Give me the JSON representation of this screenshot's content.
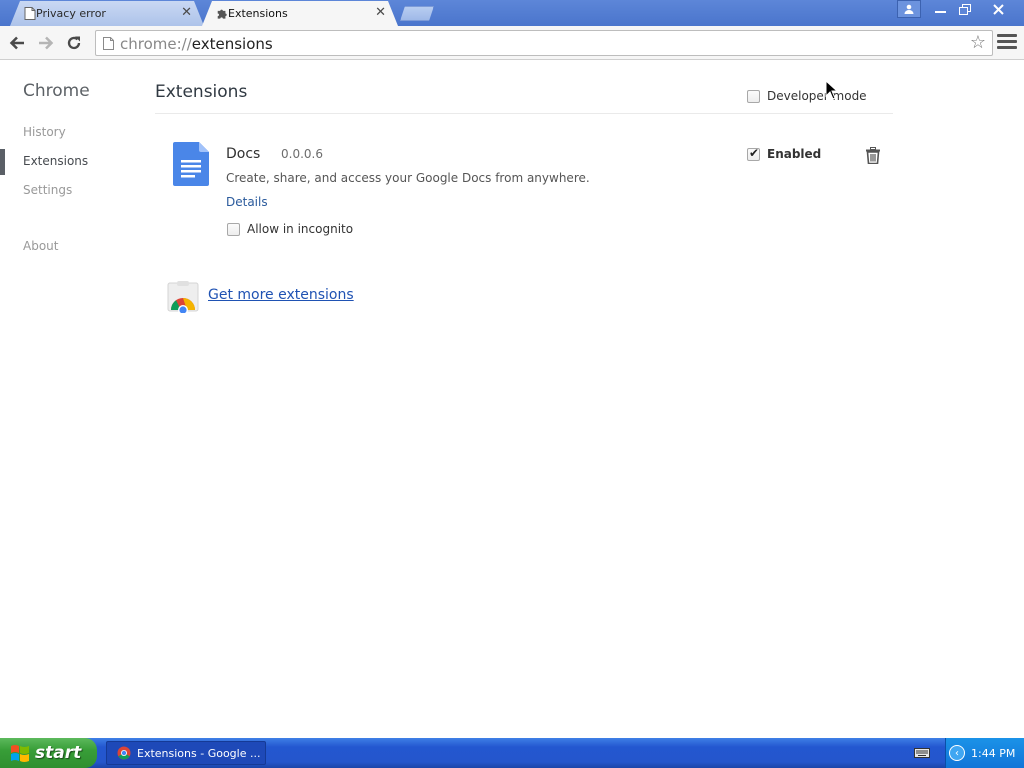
{
  "tabs": [
    {
      "label": "Privacy error",
      "close": "✕",
      "active": false
    },
    {
      "label": "Extensions",
      "close": "✕",
      "active": true
    }
  ],
  "toolbar": {
    "url_scheme": "chrome://",
    "url_path": "extensions"
  },
  "sidebar": {
    "brand": "Chrome",
    "items": [
      {
        "label": "History"
      },
      {
        "label": "Extensions",
        "selected": true
      },
      {
        "label": "Settings"
      },
      {
        "label": "About"
      }
    ]
  },
  "main": {
    "title": "Extensions",
    "developer_mode": {
      "label": "Developer mode",
      "checked": false
    },
    "extensions": [
      {
        "name": "Docs",
        "version": "0.0.0.6",
        "description": "Create, share, and access your Google Docs from anywhere.",
        "details_label": "Details",
        "incognito_label": "Allow in incognito",
        "incognito_checked": false,
        "enabled_label": "Enabled",
        "enabled": true
      }
    ],
    "more_extensions_label": "Get more extensions"
  },
  "taskbar": {
    "start_label": "start",
    "task_label": "Extensions - Google ...",
    "clock": "1:44 PM"
  },
  "colors": {
    "titlebar": "#4a75cc",
    "link": "#1f52b3",
    "docs_blue": "#4a86e8",
    "taskbar": "#2456cc",
    "start_green": "#389e38"
  }
}
